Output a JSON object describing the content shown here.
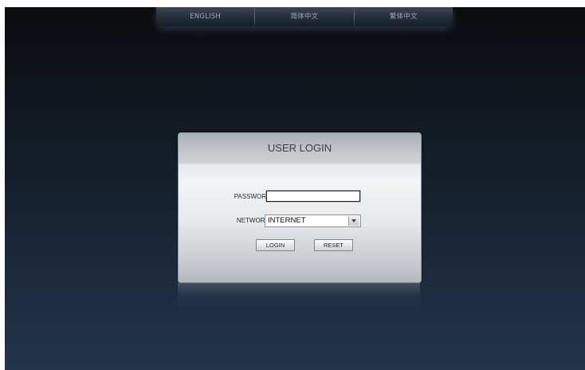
{
  "languages": {
    "english": "ENGLISH",
    "simplified": "简体中文",
    "traditional": "繁体中文"
  },
  "login": {
    "title": "USER LOGIN",
    "password_label": "PASSWORD:",
    "password_value": "",
    "network_label": "NETWORK:",
    "network_value": "INTERNET",
    "login_button": "LOGIN",
    "reset_button": "RESET"
  }
}
